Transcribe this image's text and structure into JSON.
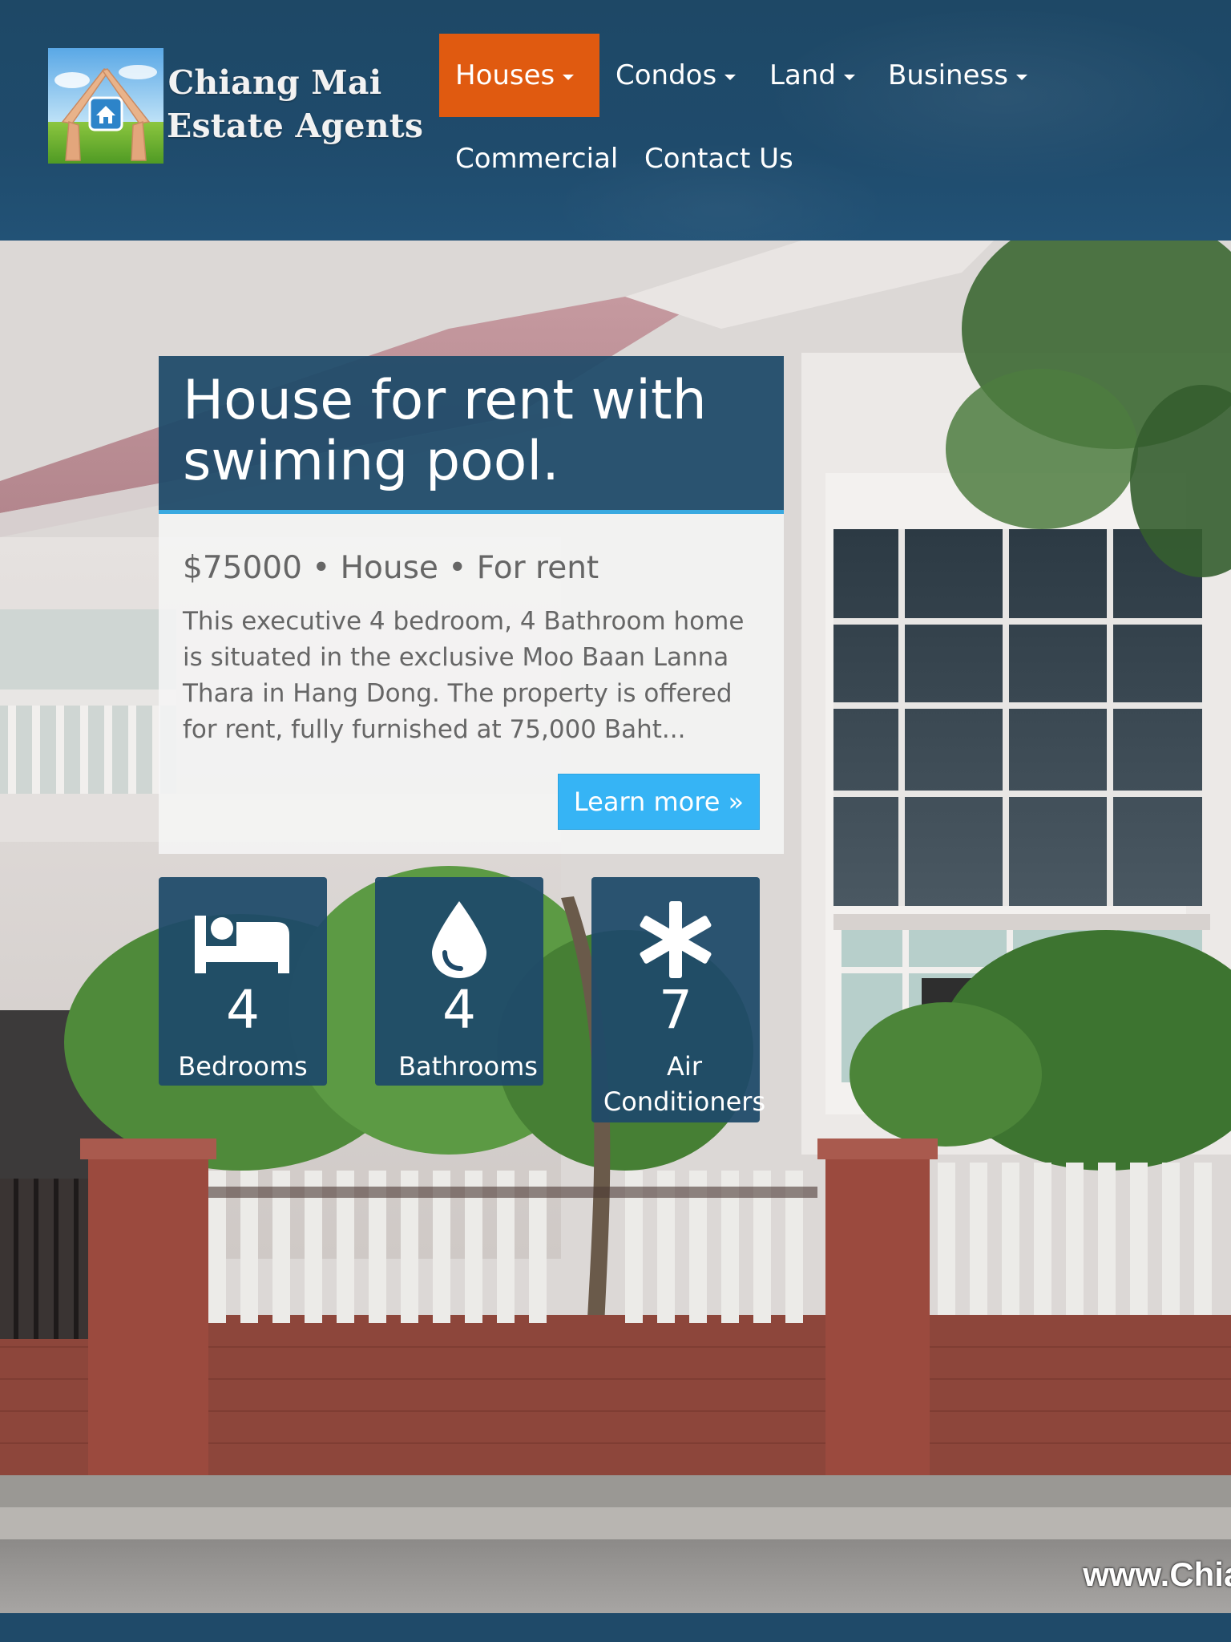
{
  "brand": {
    "line1": "Chiang Mai",
    "line2": "Estate Agents",
    "logo_icon": "house-hands-icon"
  },
  "nav": {
    "items": [
      {
        "label": "Houses",
        "dropdown": true,
        "active": true
      },
      {
        "label": "Condos",
        "dropdown": true,
        "active": false
      },
      {
        "label": "Land",
        "dropdown": true,
        "active": false
      },
      {
        "label": "Business",
        "dropdown": true,
        "active": false
      },
      {
        "label": "Commercial",
        "dropdown": false,
        "active": false
      },
      {
        "label": "Contact Us",
        "dropdown": false,
        "active": false
      }
    ]
  },
  "listing": {
    "title": "House for rent with swiming pool.",
    "meta": "$75000 • House • For rent",
    "description": "This executive 4 bedroom, 4 Bathroom home is situated in the exclusive Moo Baan Lanna Thara in Hang Dong. The property is offered for rent, fully furnished at 75,000 Baht...",
    "cta_label": "Learn more »"
  },
  "features": [
    {
      "icon": "bed-icon",
      "value": "4",
      "label": "Bedrooms"
    },
    {
      "icon": "water-drop-icon",
      "value": "4",
      "label": "Bathrooms"
    },
    {
      "icon": "snowflake-asterisk-icon",
      "value": "7",
      "label": "Air Conditioners"
    }
  ],
  "watermark": "www.Chian",
  "colors": {
    "header_bg": "#1f4a69",
    "nav_active": "#e05a10",
    "accent_blue": "#36b4f5",
    "title_underline": "#3aa9e0"
  }
}
